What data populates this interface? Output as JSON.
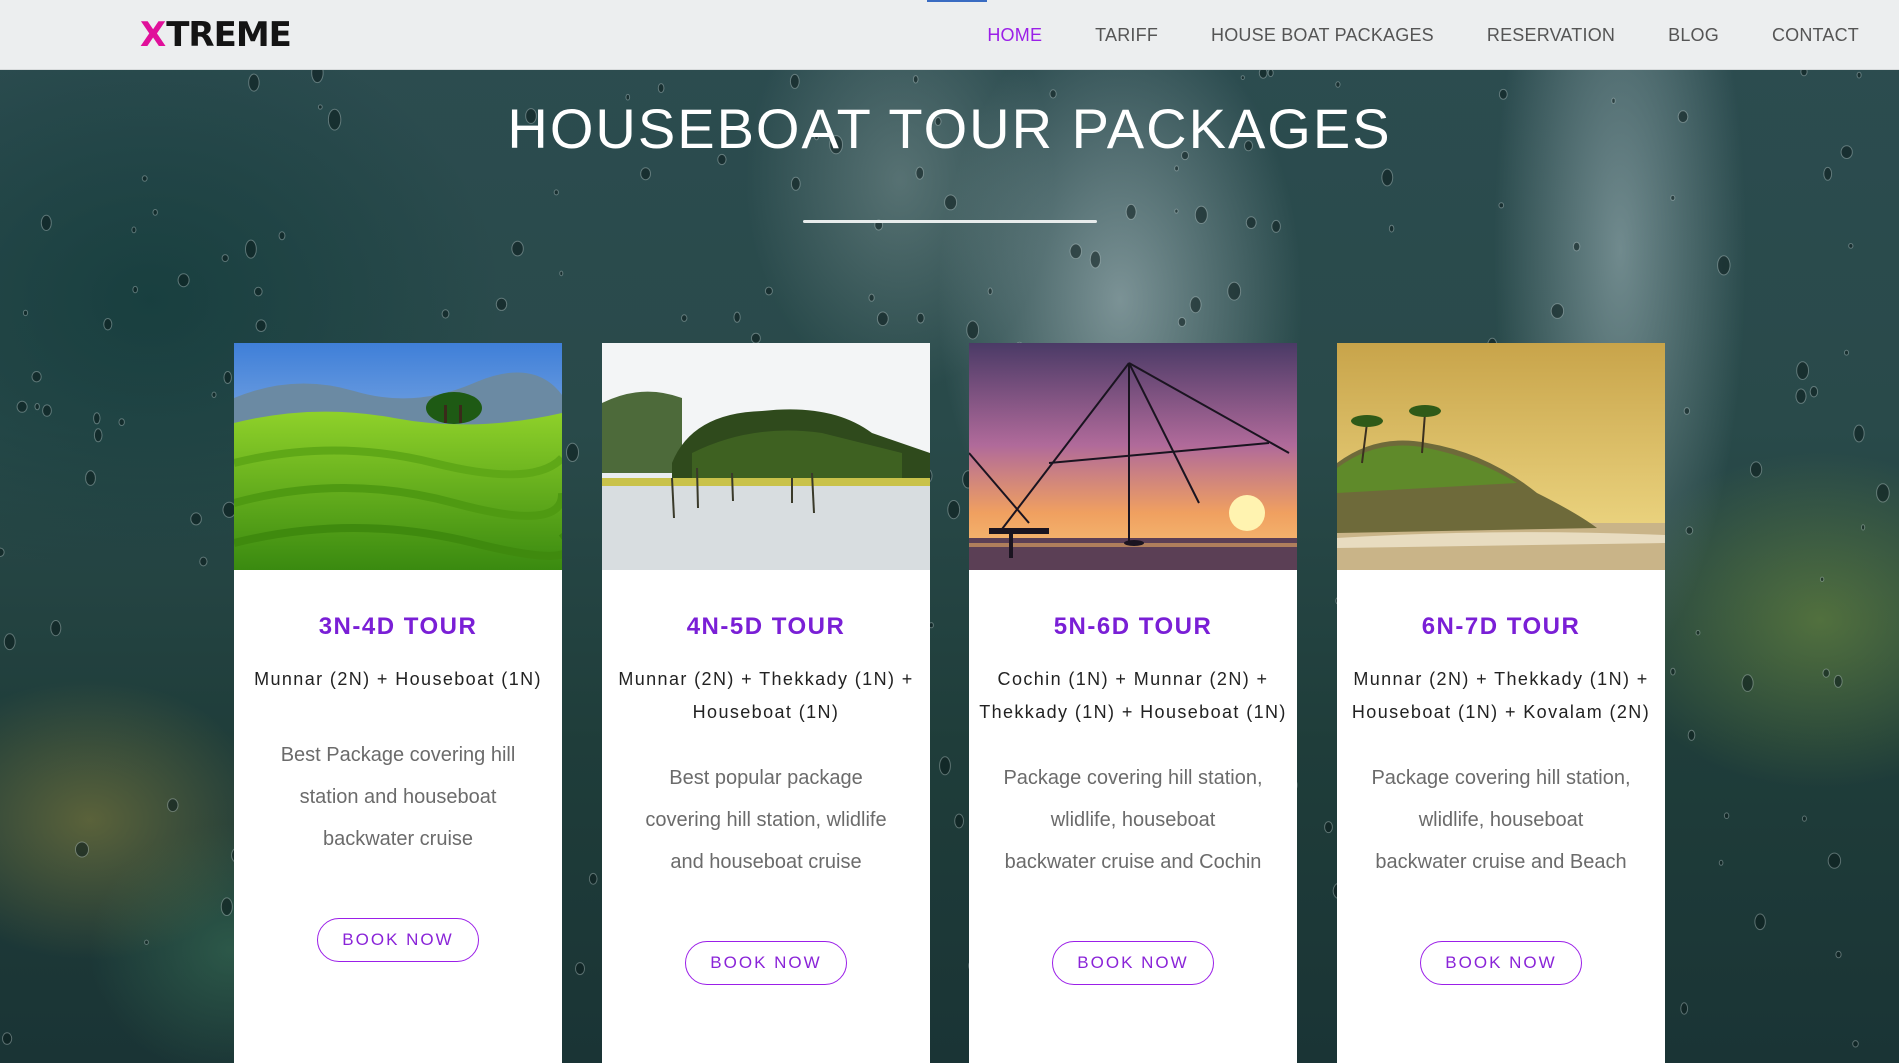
{
  "brand": {
    "logo_text": "XTREME",
    "logo_x": "X",
    "logo_rest": "TREME",
    "accent": "#9b1fe8",
    "logo_accent": "#e0109a"
  },
  "nav": {
    "items": [
      {
        "label": "HOME",
        "active": true
      },
      {
        "label": "TARIFF",
        "active": false
      },
      {
        "label": "HOUSE BOAT PACKAGES",
        "active": false
      },
      {
        "label": "RESERVATION",
        "active": false
      },
      {
        "label": "BLOG",
        "active": false
      },
      {
        "label": "CONTACT",
        "active": false
      }
    ]
  },
  "section": {
    "title": "HOUSEBOAT TOUR PACKAGES"
  },
  "packages": [
    {
      "title": "3N-4D TOUR",
      "route": "Munnar (2N) + Houseboat (1N)",
      "description": "Best Package covering hill station and houseboat backwater cruise",
      "button": "BOOK NOW",
      "image": "tea-plantation-hills"
    },
    {
      "title": "4N-5D TOUR",
      "route": "Munnar (2N) + Thekkady (1N) + Houseboat (1N)",
      "description": "Best popular package covering hill station, wlidlife and houseboat cruise",
      "button": "BOOK NOW",
      "image": "lake-forest-island"
    },
    {
      "title": "5N-6D TOUR",
      "route": "Cochin (1N) + Munnar (2N) + Thekkady (1N) + Houseboat (1N)",
      "description": "Package covering hill station, wlidlife, houseboat backwater cruise and Cochin",
      "button": "BOOK NOW",
      "image": "chinese-fishing-nets-sunset"
    },
    {
      "title": "6N-7D TOUR",
      "route": "Munnar (2N) + Thekkady (1N) + Houseboat (1N) + Kovalam (2N)",
      "description": "Package covering hill station, wlidlife, houseboat backwater cruise and Beach",
      "button": "BOOK NOW",
      "image": "beach-palm-headland"
    }
  ]
}
